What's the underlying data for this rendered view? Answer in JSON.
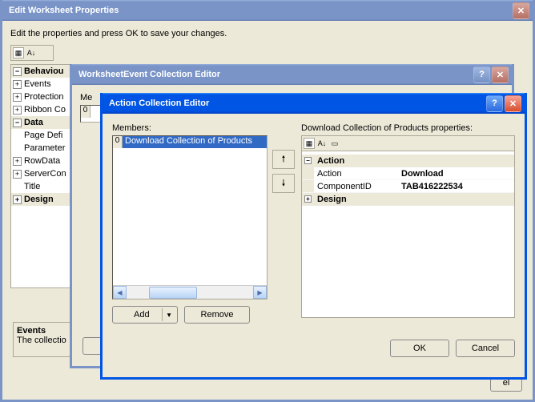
{
  "parent_window": {
    "title": "Edit Worksheet Properties",
    "instruction": "Edit the properties and press OK to save your changes.",
    "categories": {
      "behaviour": "Behaviou",
      "data": "Data",
      "design": "Design"
    },
    "items": {
      "events": "Events",
      "protection": "Protection",
      "ribbon": "Ribbon Co",
      "pagedef": "Page Defi",
      "parameter": "Parameter",
      "rowdata": "RowData",
      "servercon": "ServerCon",
      "title": "Title"
    },
    "desc": {
      "title": "Events",
      "text": "The collectio"
    }
  },
  "mid_window": {
    "title": "WorksheetEvent Collection Editor",
    "members_label": "Me",
    "item_index": "0"
  },
  "dialog": {
    "title": "Action Collection Editor",
    "members_label": "Members:",
    "props_label": "Download Collection of Products properties:",
    "item": {
      "index": "0",
      "label": "Download Collection of Products"
    },
    "add_label": "Add",
    "remove_label": "Remove",
    "ok_label": "OK",
    "cancel_label": "Cancel",
    "propgrid": {
      "cat_action": "Action",
      "cat_design": "Design",
      "rows": [
        {
          "name": "Action",
          "value": "Download"
        },
        {
          "name": "ComponentID",
          "value": "TAB416222534"
        }
      ]
    }
  }
}
